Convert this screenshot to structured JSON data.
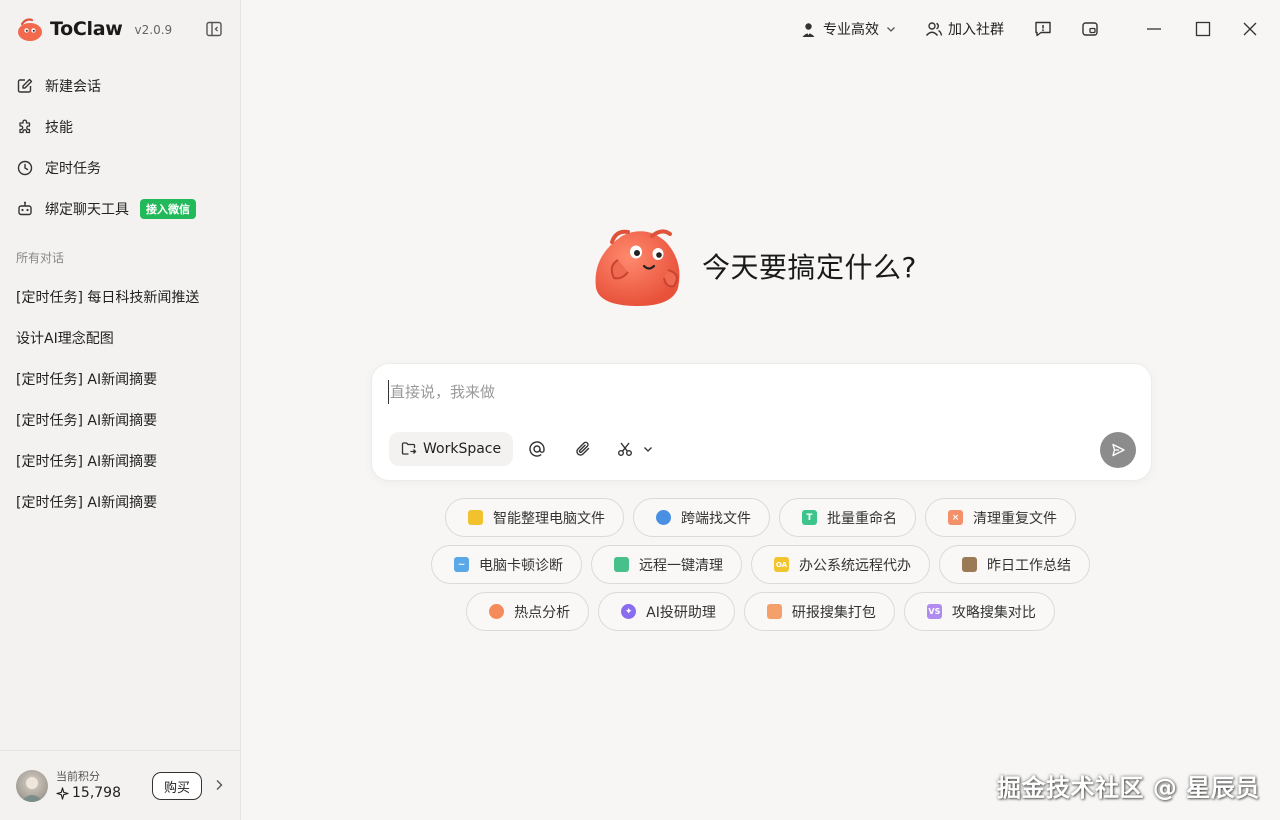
{
  "app": {
    "name": "ToClaw",
    "version": "v2.0.9"
  },
  "sidebar": {
    "nav": [
      {
        "label": "新建会话",
        "icon": "edit-icon"
      },
      {
        "label": "技能",
        "icon": "puzzle-icon"
      },
      {
        "label": "定时任务",
        "icon": "clock-icon"
      },
      {
        "label": "绑定聊天工具",
        "icon": "robot-icon",
        "badge": "接入微信"
      }
    ],
    "section_label": "所有对话",
    "conversations": [
      "[定时任务] 每日科技新闻推送",
      "设计AI理念配图",
      "[定时任务] AI新闻摘要",
      "[定时任务] AI新闻摘要",
      "[定时任务] AI新闻摘要",
      "[定时任务] AI新闻摘要"
    ],
    "user": {
      "points_label": "当前积分",
      "points_value": "15,798",
      "buy_label": "购买"
    }
  },
  "titlebar": {
    "mode_label": "专业高效",
    "community_label": "加入社群"
  },
  "main": {
    "greeting": "今天要搞定什么?",
    "input": {
      "placeholder": "直接说，我来做",
      "value": ""
    },
    "workspace_label": "WorkSpace",
    "suggestions": [
      [
        {
          "label": "智能整理电脑文件",
          "icon": "folder-icon",
          "color": "#f2c12e"
        },
        {
          "label": "跨端找文件",
          "icon": "search-icon",
          "color": "#4a90e2"
        },
        {
          "label": "批量重命名",
          "icon": "text-t-icon",
          "color": "#3cc48a"
        },
        {
          "label": "清理重复文件",
          "icon": "delete-box-icon",
          "color": "#f2916a"
        }
      ],
      [
        {
          "label": "电脑卡顿诊断",
          "icon": "monitor-pulse-icon",
          "color": "#5aa8e8"
        },
        {
          "label": "远程一键清理",
          "icon": "broom-icon",
          "color": "#48c08c"
        },
        {
          "label": "办公系统远程代办",
          "icon": "oa-icon",
          "color": "#f2c52e"
        },
        {
          "label": "昨日工作总结",
          "icon": "briefcase-icon",
          "color": "#9a7b56"
        }
      ],
      [
        {
          "label": "热点分析",
          "icon": "fire-icon",
          "color": "#f58a5a"
        },
        {
          "label": "AI投研助理",
          "icon": "sparkle-icon",
          "color": "#8a6cf0"
        },
        {
          "label": "研报搜集打包",
          "icon": "package-icon",
          "color": "#f5a06a"
        },
        {
          "label": "攻略搜集对比",
          "icon": "vs-icon",
          "color": "#b08cf0"
        }
      ]
    ]
  },
  "watermark": "掘金技术社区 @ 星辰员"
}
